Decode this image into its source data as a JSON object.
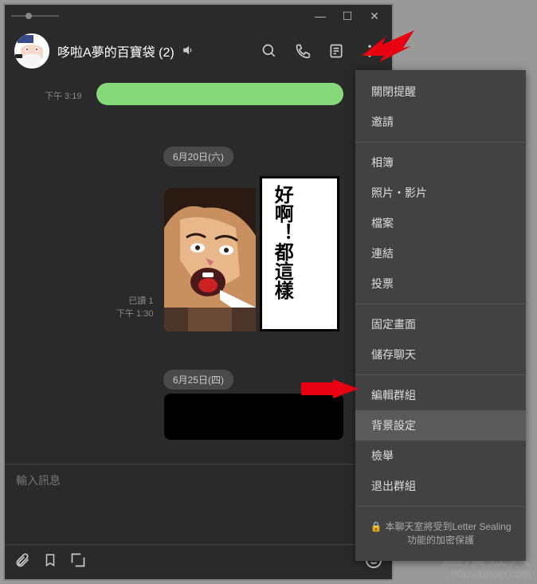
{
  "window": {
    "min": "—",
    "max": "☐",
    "close": "✕"
  },
  "header": {
    "title": "哆啦A夢的百寶袋 (2)"
  },
  "messages": {
    "ts1": "下午 3:19",
    "date1": "6月20日(六)",
    "date2": "6月25日(四)",
    "read": "已讀 1",
    "readTime": "下午 1:30",
    "speech": "好啊！都這樣"
  },
  "input": {
    "placeholder": "輸入訊息"
  },
  "menu": {
    "items": [
      "關閉提醒",
      "邀請",
      "相簿",
      "照片・影片",
      "檔案",
      "連結",
      "投票",
      "固定畫面",
      "儲存聊天",
      "編輯群組",
      "背景設定",
      "檢舉",
      "退出群組"
    ],
    "footer": "本聊天室將受到Letter Sealing功能的加密保護"
  },
  "watermark": {
    "text": "重灌狂人",
    "url": "http://briian.com"
  }
}
